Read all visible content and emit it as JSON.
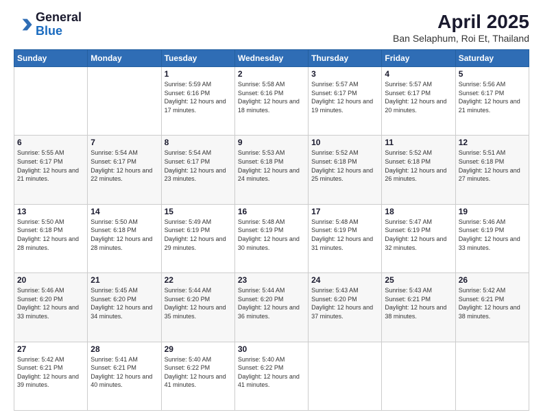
{
  "logo": {
    "line1": "General",
    "line2": "Blue"
  },
  "title": "April 2025",
  "subtitle": "Ban Selaphum, Roi Et, Thailand",
  "weekdays": [
    "Sunday",
    "Monday",
    "Tuesday",
    "Wednesday",
    "Thursday",
    "Friday",
    "Saturday"
  ],
  "weeks": [
    [
      {
        "day": "",
        "sunrise": "",
        "sunset": "",
        "daylight": ""
      },
      {
        "day": "",
        "sunrise": "",
        "sunset": "",
        "daylight": ""
      },
      {
        "day": "1",
        "sunrise": "Sunrise: 5:59 AM",
        "sunset": "Sunset: 6:16 PM",
        "daylight": "Daylight: 12 hours and 17 minutes."
      },
      {
        "day": "2",
        "sunrise": "Sunrise: 5:58 AM",
        "sunset": "Sunset: 6:16 PM",
        "daylight": "Daylight: 12 hours and 18 minutes."
      },
      {
        "day": "3",
        "sunrise": "Sunrise: 5:57 AM",
        "sunset": "Sunset: 6:17 PM",
        "daylight": "Daylight: 12 hours and 19 minutes."
      },
      {
        "day": "4",
        "sunrise": "Sunrise: 5:57 AM",
        "sunset": "Sunset: 6:17 PM",
        "daylight": "Daylight: 12 hours and 20 minutes."
      },
      {
        "day": "5",
        "sunrise": "Sunrise: 5:56 AM",
        "sunset": "Sunset: 6:17 PM",
        "daylight": "Daylight: 12 hours and 21 minutes."
      }
    ],
    [
      {
        "day": "6",
        "sunrise": "Sunrise: 5:55 AM",
        "sunset": "Sunset: 6:17 PM",
        "daylight": "Daylight: 12 hours and 21 minutes."
      },
      {
        "day": "7",
        "sunrise": "Sunrise: 5:54 AM",
        "sunset": "Sunset: 6:17 PM",
        "daylight": "Daylight: 12 hours and 22 minutes."
      },
      {
        "day": "8",
        "sunrise": "Sunrise: 5:54 AM",
        "sunset": "Sunset: 6:17 PM",
        "daylight": "Daylight: 12 hours and 23 minutes."
      },
      {
        "day": "9",
        "sunrise": "Sunrise: 5:53 AM",
        "sunset": "Sunset: 6:18 PM",
        "daylight": "Daylight: 12 hours and 24 minutes."
      },
      {
        "day": "10",
        "sunrise": "Sunrise: 5:52 AM",
        "sunset": "Sunset: 6:18 PM",
        "daylight": "Daylight: 12 hours and 25 minutes."
      },
      {
        "day": "11",
        "sunrise": "Sunrise: 5:52 AM",
        "sunset": "Sunset: 6:18 PM",
        "daylight": "Daylight: 12 hours and 26 minutes."
      },
      {
        "day": "12",
        "sunrise": "Sunrise: 5:51 AM",
        "sunset": "Sunset: 6:18 PM",
        "daylight": "Daylight: 12 hours and 27 minutes."
      }
    ],
    [
      {
        "day": "13",
        "sunrise": "Sunrise: 5:50 AM",
        "sunset": "Sunset: 6:18 PM",
        "daylight": "Daylight: 12 hours and 28 minutes."
      },
      {
        "day": "14",
        "sunrise": "Sunrise: 5:50 AM",
        "sunset": "Sunset: 6:18 PM",
        "daylight": "Daylight: 12 hours and 28 minutes."
      },
      {
        "day": "15",
        "sunrise": "Sunrise: 5:49 AM",
        "sunset": "Sunset: 6:19 PM",
        "daylight": "Daylight: 12 hours and 29 minutes."
      },
      {
        "day": "16",
        "sunrise": "Sunrise: 5:48 AM",
        "sunset": "Sunset: 6:19 PM",
        "daylight": "Daylight: 12 hours and 30 minutes."
      },
      {
        "day": "17",
        "sunrise": "Sunrise: 5:48 AM",
        "sunset": "Sunset: 6:19 PM",
        "daylight": "Daylight: 12 hours and 31 minutes."
      },
      {
        "day": "18",
        "sunrise": "Sunrise: 5:47 AM",
        "sunset": "Sunset: 6:19 PM",
        "daylight": "Daylight: 12 hours and 32 minutes."
      },
      {
        "day": "19",
        "sunrise": "Sunrise: 5:46 AM",
        "sunset": "Sunset: 6:19 PM",
        "daylight": "Daylight: 12 hours and 33 minutes."
      }
    ],
    [
      {
        "day": "20",
        "sunrise": "Sunrise: 5:46 AM",
        "sunset": "Sunset: 6:20 PM",
        "daylight": "Daylight: 12 hours and 33 minutes."
      },
      {
        "day": "21",
        "sunrise": "Sunrise: 5:45 AM",
        "sunset": "Sunset: 6:20 PM",
        "daylight": "Daylight: 12 hours and 34 minutes."
      },
      {
        "day": "22",
        "sunrise": "Sunrise: 5:44 AM",
        "sunset": "Sunset: 6:20 PM",
        "daylight": "Daylight: 12 hours and 35 minutes."
      },
      {
        "day": "23",
        "sunrise": "Sunrise: 5:44 AM",
        "sunset": "Sunset: 6:20 PM",
        "daylight": "Daylight: 12 hours and 36 minutes."
      },
      {
        "day": "24",
        "sunrise": "Sunrise: 5:43 AM",
        "sunset": "Sunset: 6:20 PM",
        "daylight": "Daylight: 12 hours and 37 minutes."
      },
      {
        "day": "25",
        "sunrise": "Sunrise: 5:43 AM",
        "sunset": "Sunset: 6:21 PM",
        "daylight": "Daylight: 12 hours and 38 minutes."
      },
      {
        "day": "26",
        "sunrise": "Sunrise: 5:42 AM",
        "sunset": "Sunset: 6:21 PM",
        "daylight": "Daylight: 12 hours and 38 minutes."
      }
    ],
    [
      {
        "day": "27",
        "sunrise": "Sunrise: 5:42 AM",
        "sunset": "Sunset: 6:21 PM",
        "daylight": "Daylight: 12 hours and 39 minutes."
      },
      {
        "day": "28",
        "sunrise": "Sunrise: 5:41 AM",
        "sunset": "Sunset: 6:21 PM",
        "daylight": "Daylight: 12 hours and 40 minutes."
      },
      {
        "day": "29",
        "sunrise": "Sunrise: 5:40 AM",
        "sunset": "Sunset: 6:22 PM",
        "daylight": "Daylight: 12 hours and 41 minutes."
      },
      {
        "day": "30",
        "sunrise": "Sunrise: 5:40 AM",
        "sunset": "Sunset: 6:22 PM",
        "daylight": "Daylight: 12 hours and 41 minutes."
      },
      {
        "day": "",
        "sunrise": "",
        "sunset": "",
        "daylight": ""
      },
      {
        "day": "",
        "sunrise": "",
        "sunset": "",
        "daylight": ""
      },
      {
        "day": "",
        "sunrise": "",
        "sunset": "",
        "daylight": ""
      }
    ]
  ]
}
